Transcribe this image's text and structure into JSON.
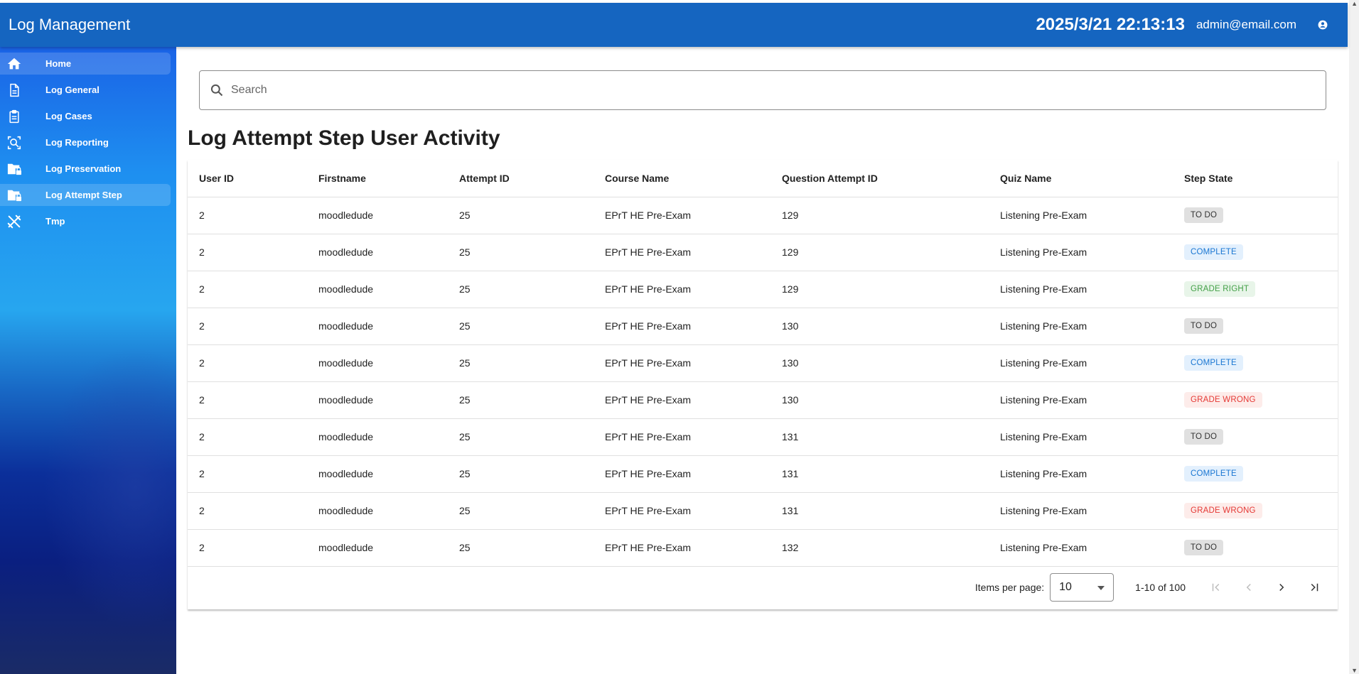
{
  "header": {
    "title": "Log Management",
    "datetime": "2025/3/21 22:13:13",
    "user_email": "admin@email.com"
  },
  "sidebar": {
    "items": [
      {
        "label": "Home",
        "icon": "home-icon"
      },
      {
        "label": "Log General",
        "icon": "document-icon"
      },
      {
        "label": "Log Cases",
        "icon": "clipboard-icon"
      },
      {
        "label": "Log Reporting",
        "icon": "search-report-icon"
      },
      {
        "label": "Log Preservation",
        "icon": "folder-lock-icon"
      },
      {
        "label": "Log Attempt Step",
        "icon": "folder-lock-icon"
      },
      {
        "label": "Tmp",
        "icon": "tools-icon"
      }
    ]
  },
  "search": {
    "placeholder": "Search"
  },
  "page_title": "Log Attempt Step User Activity",
  "table": {
    "headers": [
      "User ID",
      "Firstname",
      "Attempt ID",
      "Course Name",
      "Question Attempt ID",
      "Quiz Name",
      "Step State"
    ],
    "rows": [
      [
        "2",
        "moodledude",
        "25",
        "EPrT HE Pre-Exam",
        "129",
        "Listening Pre-Exam",
        "TO DO"
      ],
      [
        "2",
        "moodledude",
        "25",
        "EPrT HE Pre-Exam",
        "129",
        "Listening Pre-Exam",
        "COMPLETE"
      ],
      [
        "2",
        "moodledude",
        "25",
        "EPrT HE Pre-Exam",
        "129",
        "Listening Pre-Exam",
        "GRADE RIGHT"
      ],
      [
        "2",
        "moodledude",
        "25",
        "EPrT HE Pre-Exam",
        "130",
        "Listening Pre-Exam",
        "TO DO"
      ],
      [
        "2",
        "moodledude",
        "25",
        "EPrT HE Pre-Exam",
        "130",
        "Listening Pre-Exam",
        "COMPLETE"
      ],
      [
        "2",
        "moodledude",
        "25",
        "EPrT HE Pre-Exam",
        "130",
        "Listening Pre-Exam",
        "GRADE WRONG"
      ],
      [
        "2",
        "moodledude",
        "25",
        "EPrT HE Pre-Exam",
        "131",
        "Listening Pre-Exam",
        "TO DO"
      ],
      [
        "2",
        "moodledude",
        "25",
        "EPrT HE Pre-Exam",
        "131",
        "Listening Pre-Exam",
        "COMPLETE"
      ],
      [
        "2",
        "moodledude",
        "25",
        "EPrT HE Pre-Exam",
        "131",
        "Listening Pre-Exam",
        "GRADE WRONG"
      ],
      [
        "2",
        "moodledude",
        "25",
        "EPrT HE Pre-Exam",
        "132",
        "Listening Pre-Exam",
        "TO DO"
      ]
    ]
  },
  "badge_styles": {
    "TO DO": {
      "bg": "#e0e0e0",
      "fg": "#333333"
    },
    "COMPLETE": {
      "bg": "#e3f0fd",
      "fg": "#1976d2"
    },
    "GRADE RIGHT": {
      "bg": "#e8f5e9",
      "fg": "#43a047"
    },
    "GRADE WRONG": {
      "bg": "#fdecea",
      "fg": "#e53935"
    }
  },
  "paginator": {
    "items_per_page_label": "Items per page:",
    "items_per_page": "10",
    "range": "1-10 of 100"
  },
  "colors": {
    "header_bg": "#1565c0"
  }
}
